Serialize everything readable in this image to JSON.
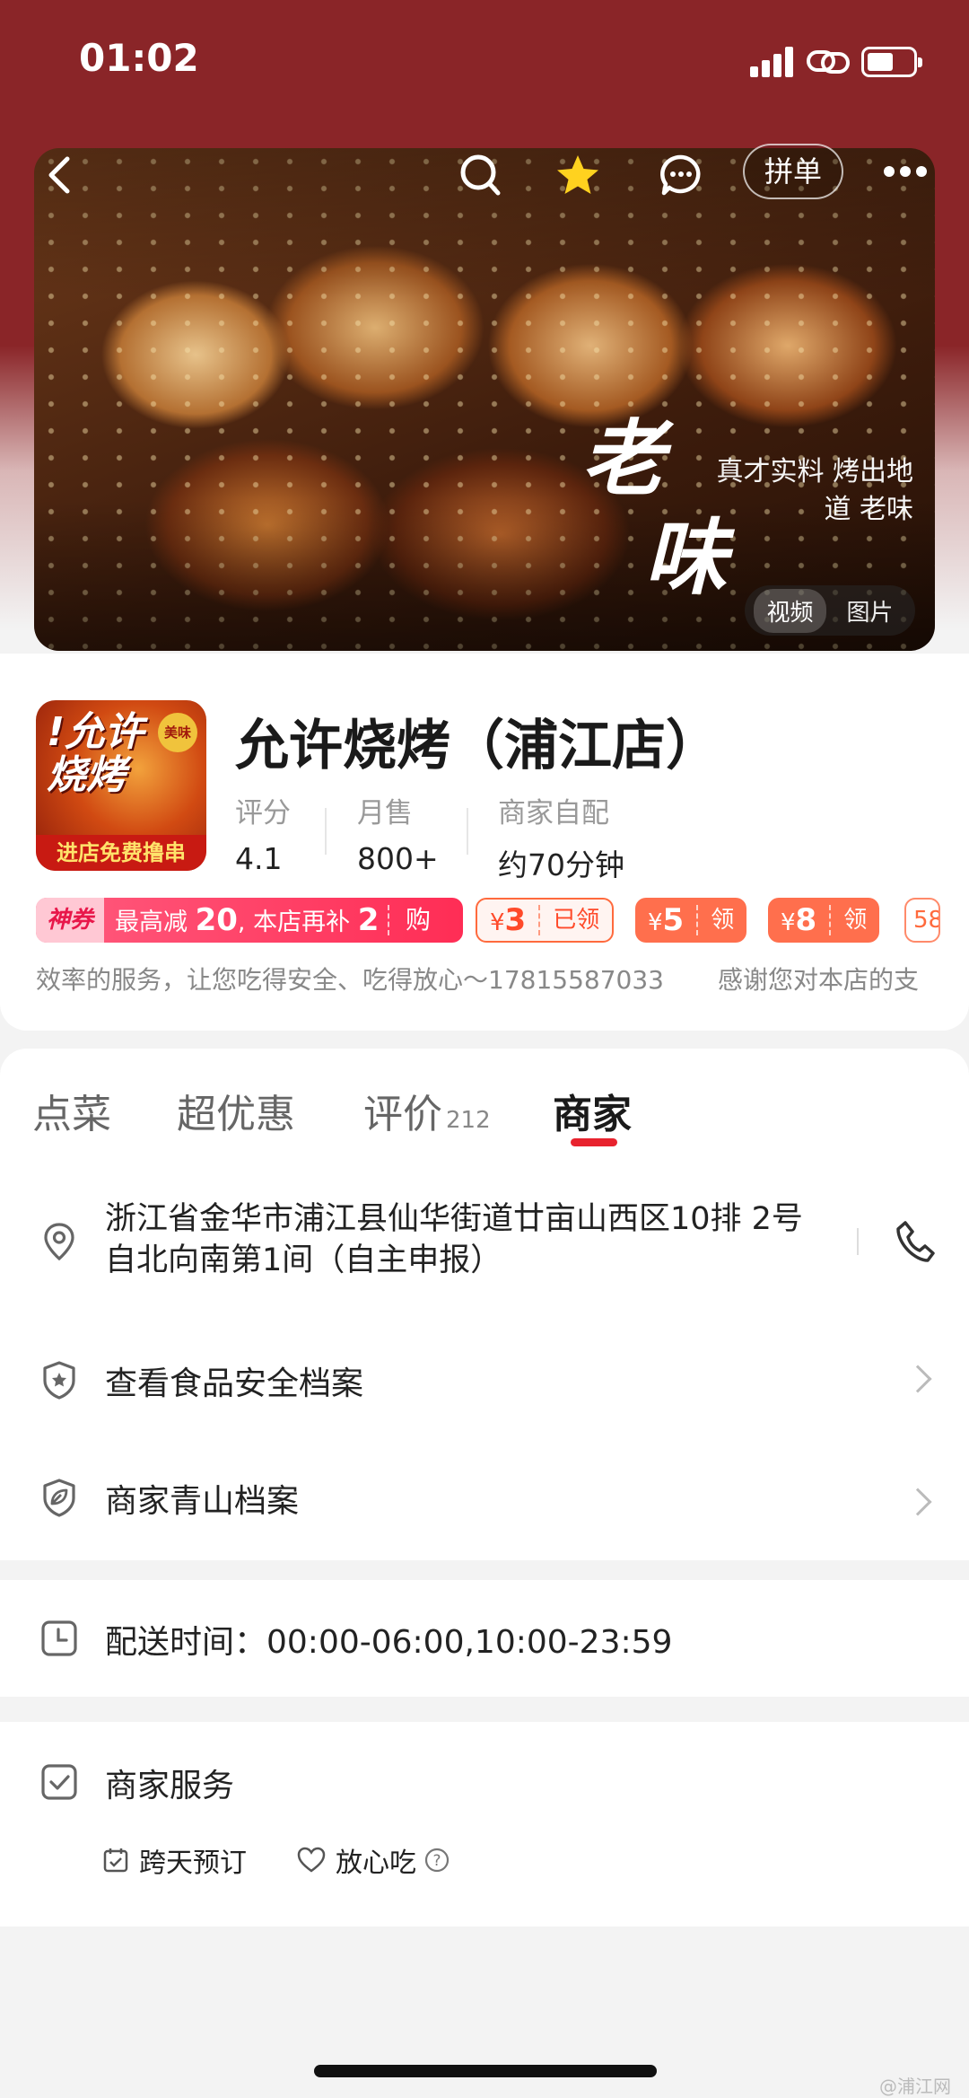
{
  "status": {
    "time": "01:02"
  },
  "hero": {
    "big_text_1": "老",
    "big_text_2": "味",
    "small_text": "真才实料 烤出地道 老味",
    "group_buy_label": "拼单",
    "media_options": [
      "视频",
      "图片"
    ]
  },
  "store": {
    "name": "允许烧烤（浦江店）",
    "logo": {
      "text_1": "!允许",
      "text_2": "烧烤",
      "badge": "美味",
      "bar": "进店免费撸串"
    },
    "stats": [
      {
        "label": "评分",
        "value": "4.1"
      },
      {
        "label": "月售",
        "value": "800+"
      },
      {
        "label": "商家自配",
        "value": "约70分钟"
      }
    ]
  },
  "coupons": {
    "shenquan": {
      "tag": "神券",
      "prefix": "最高减",
      "amount": "20",
      "middle": ", 本店再补",
      "extra": "2",
      "action": "购"
    },
    "items": [
      {
        "symbol": "¥",
        "amount": "3",
        "action": "已领",
        "state": "taken"
      },
      {
        "symbol": "¥",
        "amount": "5",
        "action": "领",
        "state": "avail"
      },
      {
        "symbol": "¥",
        "amount": "8",
        "action": "领",
        "state": "avail"
      }
    ],
    "partial_text": "58"
  },
  "notice": {
    "part_1": "效率的服务，让您吃得安全、吃得放心～17815587033",
    "part_2": "感谢您对本店的支"
  },
  "tabs": [
    {
      "label": "点菜"
    },
    {
      "label": "超优惠"
    },
    {
      "label": "评价",
      "sub": "212"
    },
    {
      "label": "商家",
      "active": true
    }
  ],
  "merchant": {
    "address": "浙江省金华市浦江县仙华街道廿亩山西区10排 2号自北向南第1间（自主申报）",
    "food_safety": "查看食品安全档案",
    "green_archive": "商家青山档案",
    "delivery_time": "配送时间：00:00-06:00,10:00-23:59",
    "services_title": "商家服务",
    "services": [
      "跨天预订",
      "放心吃"
    ]
  },
  "watermark": "@浦江网",
  "colors": {
    "brand_red": "#e8232e",
    "header_red": "#8a2528",
    "coupon_orange": "#ff6f4d",
    "coupon_pink": "#ff2d55"
  }
}
